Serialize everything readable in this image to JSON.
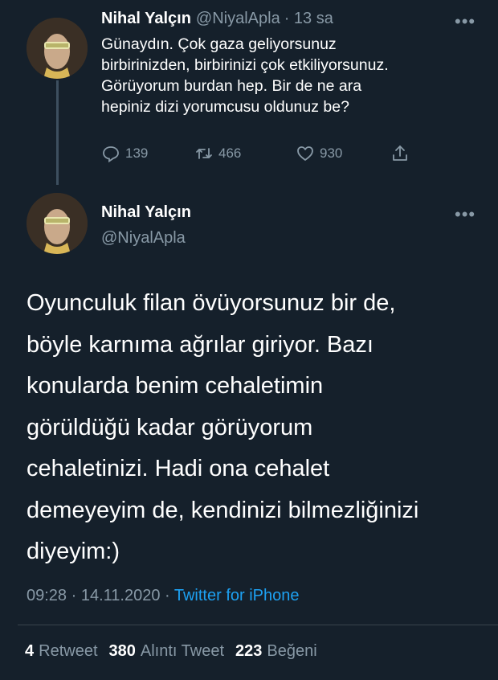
{
  "reply_tweet": {
    "name": "Nihal Yalçın",
    "handle": "@NiyalApla",
    "time": "· 13 sa",
    "more": "•••",
    "text_lines": [
      "Günaydın. Çok gaza geliyorsunuz",
      "birbirinizden, birbirinizi çok etkiliyorsunuz.",
      "Görüyorum burdan hep. Bir de ne ara",
      "hepiniz dizi yorumcusu oldunuz be?"
    ],
    "actions": {
      "reply_count": "139",
      "retweet_count": "466",
      "like_count": "930"
    },
    "icons": [
      "reply-icon",
      "retweet-icon",
      "like-icon",
      "share-icon"
    ]
  },
  "main_tweet": {
    "name": "Nihal Yalçın",
    "handle": "@NiyalApla",
    "more": "•••",
    "text_lines": [
      "Oyunculuk filan övüyorsunuz bir de,",
      "böyle karnıma ağrılar giriyor. Bazı",
      "konularda benim cehaletimin",
      "görüldüğü kadar görüyorum",
      "cehaletinizi. Hadi ona cehalet",
      "demeyeyim de, kendinizi bilmezliğinizi",
      "diyeyim:)"
    ],
    "timestamp": "09:28 · 14.11.2020 · ",
    "source": "Twitter for iPhone"
  },
  "stats": {
    "retweet_count": "4",
    "retweet_label": "Retweet",
    "quote_count": "380",
    "quote_label": "Alıntı Tweet",
    "like_count": "223",
    "like_label": "Beğeni"
  },
  "colors": {
    "background": "#15202b",
    "muted": "#8899a6",
    "link": "#1da1f2",
    "divider": "#38444d"
  }
}
